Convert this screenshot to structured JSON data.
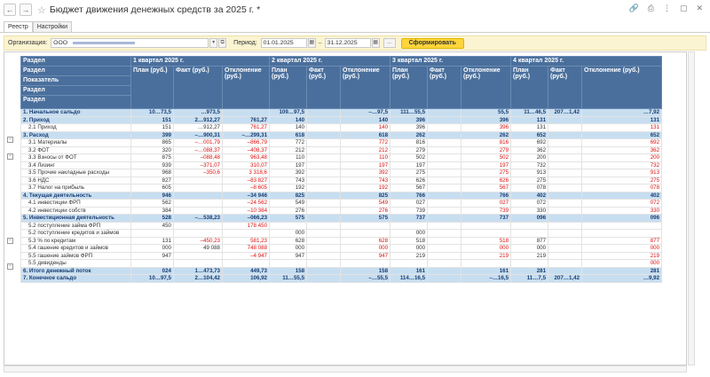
{
  "window": {
    "title": "Бюджет движения денежных средств за 2025 г.",
    "modified_mark": "*"
  },
  "tabs": [
    {
      "label": "Реестр"
    },
    {
      "label": "Настройки"
    }
  ],
  "filters": {
    "org_label": "Организация:",
    "org_value": "ООО",
    "period_label": "Период:",
    "date_from": "01.01.2025",
    "date_to": "31.12.2025",
    "dash": "–",
    "dots": "...",
    "form_button": "Сформировать"
  },
  "header": {
    "col0_lines": [
      "Раздел",
      "Раздел",
      "Показатель",
      "Раздел",
      "Раздел"
    ],
    "quarters": [
      "1 квартал 2025 г.",
      "2 квартал 2025 г.",
      "3 квартал 2025 г.",
      "4 квартал 2025 г."
    ],
    "plan": "План (руб.)",
    "fact": "Факт (руб.)",
    "dev": "Отклонение (руб.)"
  },
  "rows": [
    {
      "name": "1. Начальное сальдо",
      "type": "group",
      "v": [
        "10…73,5",
        "…973,5",
        "",
        "109…97,5",
        "",
        "–…97,5",
        "111…55,5",
        "",
        "55,5",
        "11…46,5",
        "207…1,42",
        "…7,92"
      ]
    },
    {
      "name": "2. Приход",
      "type": "group",
      "v": [
        "151",
        "2…912,27",
        "761,27",
        "140",
        "",
        "140",
        "396",
        "",
        "396",
        "131",
        "",
        "131"
      ]
    },
    {
      "name": "2.1 Приход",
      "type": "sub",
      "v": [
        "151",
        "…912,27",
        "761,27",
        "140",
        "",
        "140",
        "396",
        "",
        "396",
        "131",
        "",
        "131"
      ]
    },
    {
      "name": "3. Расход",
      "type": "group",
      "v": [
        "399",
        "–…900,31",
        "–…299,31",
        "618",
        "",
        "618",
        "262",
        "",
        "262",
        "652",
        "",
        "652"
      ]
    },
    {
      "name": "3.1 Материалы",
      "type": "sub",
      "v": [
        "865",
        "–…001,79",
        "–866,79",
        "772",
        "",
        "772",
        "816",
        "",
        "816",
        "692",
        "",
        "692"
      ]
    },
    {
      "name": "3.2 ФОТ",
      "type": "sub",
      "v": [
        "320",
        "–…088,37",
        "–408,37",
        "212",
        "",
        "212",
        "279",
        "",
        "279",
        "362",
        "",
        "362"
      ]
    },
    {
      "name": "3.3 Взносы от ФОТ",
      "type": "sub",
      "v": [
        "875",
        "–088,48",
        "963,48",
        "110",
        "",
        "110",
        "502",
        "",
        "502",
        "200",
        "",
        "200"
      ]
    },
    {
      "name": "3.4 Лизинг",
      "type": "sub",
      "v": [
        "939",
        "–371,07",
        "310,07",
        "197",
        "",
        "197",
        "197",
        "",
        "197",
        "732",
        "",
        "732"
      ]
    },
    {
      "name": "3.5 Прочие накладные расходы",
      "type": "sub",
      "v": [
        "968",
        "–350,6",
        "3 318,6",
        "392",
        "",
        "392",
        "275",
        "",
        "275",
        "913",
        "",
        "913"
      ]
    },
    {
      "name": "3.6 НДС",
      "type": "sub",
      "v": [
        "827",
        "",
        "–83 827",
        "743",
        "",
        "743",
        "626",
        "",
        "626",
        "275",
        "",
        "275"
      ]
    },
    {
      "name": "3.7 Налог на прибыль",
      "type": "sub",
      "v": [
        "605",
        "",
        "–8 605",
        "192",
        "",
        "192",
        "567",
        "",
        "567",
        "078",
        "",
        "078"
      ]
    },
    {
      "name": "4. Текущая деятельность",
      "type": "group",
      "v": [
        "946",
        "",
        "–34 946",
        "825",
        "",
        "825",
        "766",
        "",
        "766",
        "402",
        "",
        "402"
      ]
    },
    {
      "name": "4.1 инвестиции ФРП",
      "type": "sub",
      "v": [
        "562",
        "",
        "–24 562",
        "549",
        "",
        "549",
        "027",
        "",
        "027",
        "072",
        "",
        "072"
      ]
    },
    {
      "name": "4.2 инвестиции собств",
      "type": "sub",
      "v": [
        "384",
        "",
        "–10 384",
        "276",
        "",
        "276",
        "739",
        "",
        "739",
        "330",
        "",
        "330"
      ]
    },
    {
      "name": "5. Инвестиционная деятельность",
      "type": "group",
      "v": [
        "528",
        "–…538,23",
        "–066,23",
        "575",
        "",
        "575",
        "737",
        "",
        "737",
        "096",
        "",
        "096"
      ]
    },
    {
      "name": "5.2 поступление займа ФРП",
      "type": "sub",
      "v": [
        "450",
        "",
        "178 450",
        "",
        "",
        "",
        "",
        "",
        "",
        "",
        "",
        ""
      ]
    },
    {
      "name": "5.2 поступление кредитов и займов",
      "type": "sub",
      "v": [
        "",
        "",
        "",
        "000",
        "",
        "",
        "000",
        "",
        "",
        "",
        "",
        ""
      ]
    },
    {
      "name": "5.3 % по кредитам",
      "type": "sub",
      "v": [
        "131",
        "–450,23",
        "581,23",
        "628",
        "",
        "628",
        "518",
        "",
        "518",
        "877",
        "",
        "877"
      ]
    },
    {
      "name": "5.4 гашение кредитов и займов",
      "type": "sub",
      "v": [
        "000",
        "49 088",
        "748 088",
        "000",
        "",
        "000",
        "000",
        "",
        "000",
        "000",
        "",
        "000"
      ]
    },
    {
      "name": "5.5 гашение займов ФРП",
      "type": "sub",
      "v": [
        "947",
        "",
        "–4 947",
        "947",
        "",
        "947",
        "219",
        "",
        "219",
        "219",
        "",
        "219"
      ]
    },
    {
      "name": "5.5 дивиденды",
      "type": "sub",
      "v": [
        "",
        "",
        "",
        "",
        "",
        "",
        "",
        "",
        "",
        "",
        "",
        "000"
      ]
    },
    {
      "name": "6. Итого денежный поток",
      "type": "total",
      "v": [
        "024",
        "1…473,73",
        "449,73",
        "158",
        "",
        "158",
        "161",
        "",
        "161",
        "281",
        "",
        "281"
      ]
    },
    {
      "name": "7. Конечное сальдо",
      "type": "total",
      "v": [
        "10…97,5",
        "2…104,42",
        "106,92",
        "11…55,5",
        "",
        "–…55,5",
        "114…16,5",
        "",
        "–…16,5",
        "11…7,5",
        "207…1,42",
        "…9,92"
      ]
    }
  ]
}
